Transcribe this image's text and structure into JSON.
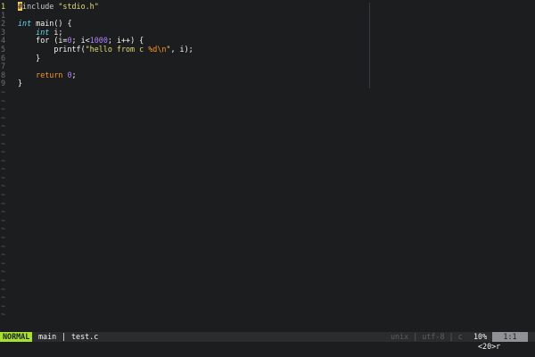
{
  "editor": {
    "lines": [
      {
        "num": "1",
        "current": true,
        "tokens": [
          {
            "t": "#",
            "c": "cursor"
          },
          {
            "t": "include ",
            "c": "t-pre"
          },
          {
            "t": "\"stdio.h\"",
            "c": "t-str"
          }
        ]
      },
      {
        "num": "1",
        "tokens": []
      },
      {
        "num": "2",
        "tokens": [
          {
            "t": "int",
            "c": "t-kw"
          },
          {
            "t": " main() {",
            "c": "t-fn"
          }
        ]
      },
      {
        "num": "3",
        "tokens": [
          {
            "t": "    ",
            "c": ""
          },
          {
            "t": "int",
            "c": "t-kw"
          },
          {
            "t": " i;",
            "c": "t-punct"
          }
        ]
      },
      {
        "num": "4",
        "tokens": [
          {
            "t": "    for (i=",
            "c": "t-ctrl"
          },
          {
            "t": "0",
            "c": "t-num"
          },
          {
            "t": "; i<",
            "c": "t-punct"
          },
          {
            "t": "1000",
            "c": "t-num"
          },
          {
            "t": "; i++) {",
            "c": "t-punct"
          }
        ]
      },
      {
        "num": "5",
        "tokens": [
          {
            "t": "        printf(",
            "c": "t-fn"
          },
          {
            "t": "\"hello from c ",
            "c": "t-str"
          },
          {
            "t": "%d\\n",
            "c": "t-esc"
          },
          {
            "t": "\"",
            "c": "t-str"
          },
          {
            "t": ", i);",
            "c": "t-punct"
          }
        ]
      },
      {
        "num": "6",
        "tokens": [
          {
            "t": "    }",
            "c": "t-punct"
          }
        ]
      },
      {
        "num": "7",
        "tokens": []
      },
      {
        "num": "8",
        "tokens": [
          {
            "t": "    return ",
            "c": "t-ret"
          },
          {
            "t": "0",
            "c": "t-num"
          },
          {
            "t": ";",
            "c": "t-punct"
          }
        ]
      },
      {
        "num": "9",
        "tokens": [
          {
            "t": "}",
            "c": "t-punct"
          }
        ]
      }
    ],
    "empty_marker": "~",
    "empty_lines": 27
  },
  "statusbar": {
    "mode": "NORMAL",
    "branch": "main",
    "separator": "|",
    "filename": "test.c",
    "fileinfo": "unix | utf-8 | c",
    "percent": "10%",
    "position": "1:1"
  },
  "cmdline": {
    "text": "<20>r"
  }
}
